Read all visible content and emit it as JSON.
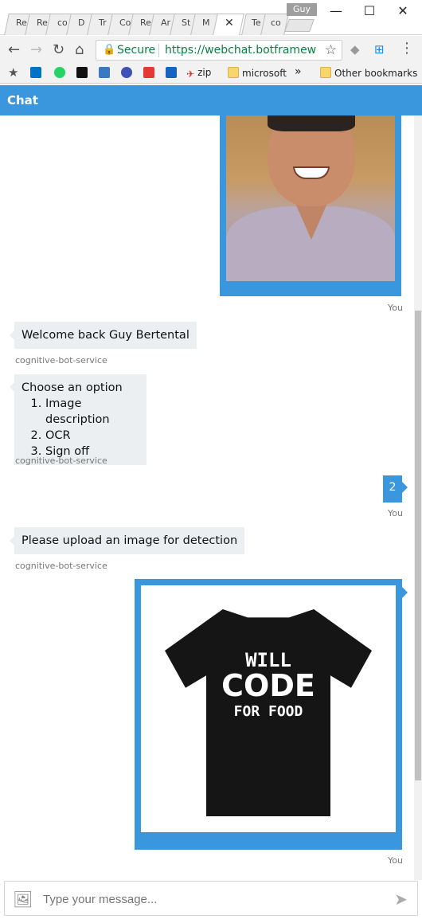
{
  "browser": {
    "profile_name": "Guy",
    "tabs": [
      "Re",
      "Re",
      "co",
      "D",
      "Tr",
      "Co",
      "Re",
      "Ar",
      "St",
      "M",
      "",
      "Te",
      "co"
    ],
    "window_controls": {
      "minimize": "—",
      "maximize": "☐",
      "close": "✕"
    },
    "nav": {
      "back": "←",
      "forward": "→",
      "reload": "↻",
      "home": "⌂"
    },
    "secure_label": "Secure",
    "url": "https://webchat.botframework.c",
    "bookmarks": [
      "zip",
      "microsoft"
    ],
    "more_bookmarks": "»",
    "other_bookmarks": "Other bookmarks"
  },
  "chat": {
    "header_title": "Chat",
    "messages": [
      {
        "from": "user",
        "type": "image",
        "meta": "You"
      },
      {
        "from": "bot",
        "text": "Welcome back Guy Bertental",
        "meta": "cognitive-bot-service"
      },
      {
        "from": "bot",
        "text": "Choose an option",
        "options": [
          "Image description",
          "OCR",
          "Sign off"
        ],
        "meta": "cognitive-bot-service"
      },
      {
        "from": "user",
        "text": "2",
        "meta": "You"
      },
      {
        "from": "bot",
        "text": "Please upload an image for detection",
        "meta": "cognitive-bot-service"
      },
      {
        "from": "user",
        "type": "image",
        "image_text": [
          "WILL",
          "CODE",
          "FOR FOOD"
        ],
        "meta": "You"
      }
    ],
    "composer": {
      "placeholder": "Type your message..."
    }
  },
  "colors": {
    "accent": "#3a96dd",
    "bot_bubble": "#eceff1",
    "secure_green": "#0b8043"
  }
}
